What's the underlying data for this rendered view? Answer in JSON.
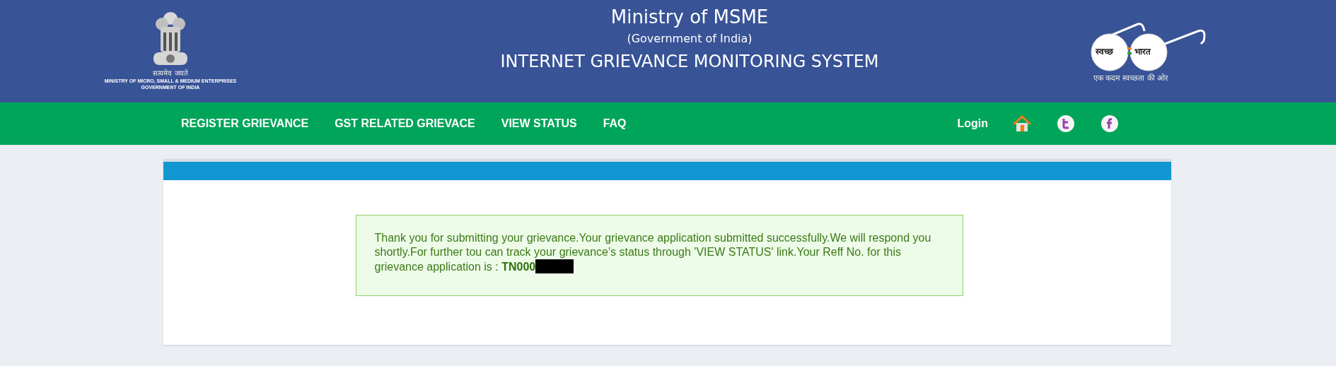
{
  "header": {
    "emblem": {
      "motto": "सत्यमेव जयते",
      "caption_lines": [
        "MINISTRY OF MICRO, SMALL & MEDIUM ENTERPRISES",
        "GOVERNMENT OF INDIA"
      ]
    },
    "title": "Ministry of MSME",
    "subtitle": "(Government of India)",
    "system_name": "INTERNET GRIEVANCE MONITORING SYSTEM",
    "swachh": {
      "left": "स्वच्छ",
      "right": "भारत",
      "tagline": "एक कदम स्वच्छता की ओर"
    }
  },
  "nav": {
    "items": [
      "REGISTER GRIEVANCE",
      "GST RELATED GRIEVACE",
      "VIEW STATUS",
      "FAQ"
    ],
    "login": "Login"
  },
  "message": {
    "text": "Thank you for submitting your grievance.Your grievance application submitted successfully.We will respond you shortly.For further tou can track your grievance's status through 'VIEW STATUS' link.Your Reff No. for this grievance application is : **TN000**",
    "redacted": true
  }
}
